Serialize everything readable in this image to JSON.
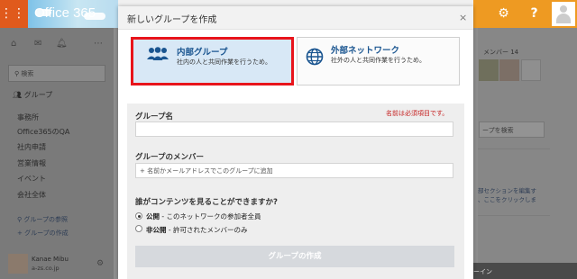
{
  "topbar": {
    "apps_icon": "apps-grid-icon",
    "logo": "Office 365",
    "gear_icon": "gear-icon",
    "help_label": "?",
    "user_icon": "user-icon",
    "colors": {
      "apps": "#e05a1c",
      "right": "#ee9a22"
    }
  },
  "sidebar": {
    "icons": [
      "home-icon",
      "mail-icon",
      "bell-icon",
      "more-icon"
    ],
    "search_placeholder": "検索",
    "group_header": "グループ",
    "items": [
      "事務所",
      "Office365のQA",
      "社内申請",
      "営業情報",
      "イベント",
      "会社全体"
    ],
    "links": [
      "グループの参照",
      "+ グループの作成"
    ],
    "user": {
      "name": "Kanae Mibu",
      "email": "a-zs.co.jp"
    }
  },
  "right_panel": {
    "members_label": "メンバー 14",
    "search_placeholder": "ープを検索",
    "note_line1": "部セクションを編集す",
    "note_line2": "、ここをクリックしま",
    "bottom_label": "ーイン"
  },
  "modal": {
    "title": "新しいグループを作成",
    "close_label": "×",
    "types": [
      {
        "title": "内部グループ",
        "desc": "社内の人と共同作業を行うため。",
        "selected": true
      },
      {
        "title": "外部ネットワーク",
        "desc": "社外の人と共同作業を行うため。",
        "selected": false
      }
    ],
    "name_label": "グループ名",
    "name_required": "名前は必須項目です。",
    "members_label": "グループのメンバー",
    "members_placeholder": "+ 名前かメールアドレスでこのグループに追加",
    "visibility_question": "誰がコンテンツを見ることができますか?",
    "options": [
      {
        "bold": "公開",
        "rest": " - このネットワークの参加者全員",
        "checked": true
      },
      {
        "bold": "非公開",
        "rest": " - 許可されたメンバーのみ",
        "checked": false
      }
    ],
    "submit_label": "グループの作成",
    "colors": {
      "highlight": "#e8141b",
      "link_blue": "#1a5590",
      "required": "#c41a1a"
    }
  }
}
